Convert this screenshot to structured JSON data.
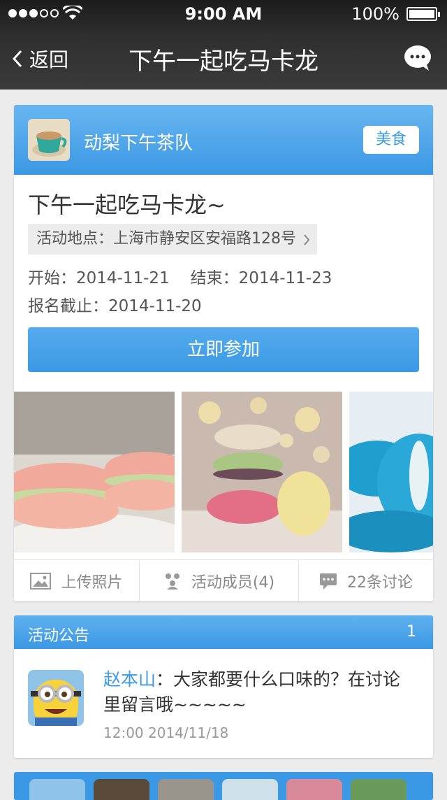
{
  "status": {
    "time": "9:00 AM",
    "battery": "100%"
  },
  "nav": {
    "back_label": "返回",
    "title": "下午一起吃马卡龙"
  },
  "team": {
    "name": "动梨下午茶队",
    "tag": "美食"
  },
  "event": {
    "title": "下午一起吃马卡龙~",
    "location": "活动地点：上海市静安区安福路128号",
    "start": "开始：2014-11-21",
    "end": "结束：2014-11-23",
    "deadline": "报名截止：2014-11-20",
    "join_label": "立即参加"
  },
  "tabs": {
    "upload": "上传照片",
    "members": "活动成员(4)",
    "discussions": "22条讨论"
  },
  "notice": {
    "header": "活动公告",
    "count": "1",
    "author": "赵本山",
    "separator": "：",
    "message": "大家都要什么口味的？在讨论里留言哦~~~~~",
    "time": "12:00  2014/11/18"
  },
  "colors": {
    "accent": "#3b98e4",
    "nav_bg": "#2f2f2f",
    "page_bg": "#ececec"
  }
}
